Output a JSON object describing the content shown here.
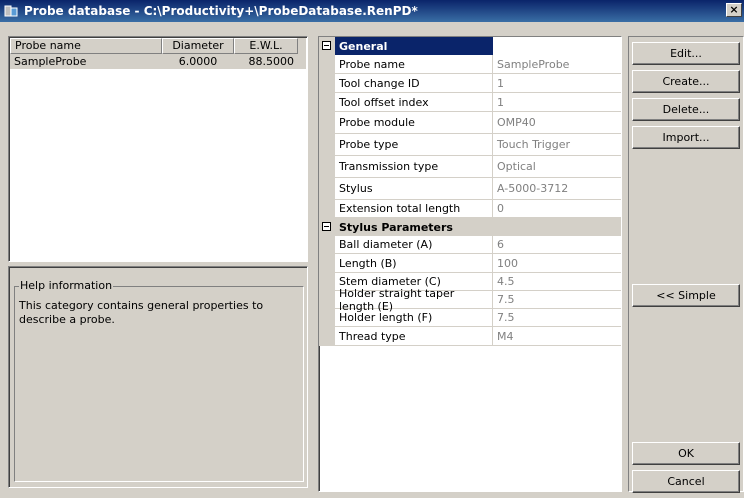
{
  "window": {
    "title": "Probe database - C:\\Productivity+\\ProbeDatabase.RenPD*",
    "close_label": "×"
  },
  "probe_list": {
    "columns": [
      "Probe name",
      "Diameter",
      "E.W.L."
    ],
    "rows": [
      {
        "name": "SampleProbe",
        "diameter": "6.0000",
        "ewl": "88.5000"
      }
    ]
  },
  "help": {
    "legend": "Help information",
    "text": "This category contains general properties to describe a probe."
  },
  "properties": {
    "general": {
      "label": "General",
      "items": [
        {
          "name": "Probe name",
          "value": "SampleProbe"
        },
        {
          "name": "Tool change ID",
          "value": "1"
        },
        {
          "name": "Tool offset index",
          "value": "1"
        },
        {
          "name": "Probe module",
          "value": "OMP40"
        },
        {
          "name": "Probe type",
          "value": "Touch Trigger"
        },
        {
          "name": "Transmission type",
          "value": "Optical"
        },
        {
          "name": "Stylus",
          "value": "A-5000-3712"
        },
        {
          "name": "Extension total length",
          "value": "0"
        }
      ]
    },
    "stylus": {
      "label": "Stylus Parameters",
      "items": [
        {
          "name": "Ball diameter (A)",
          "value": "6"
        },
        {
          "name": "Length (B)",
          "value": "100"
        },
        {
          "name": "Stem diameter (C)",
          "value": "4.5"
        },
        {
          "name": "Holder straight taper length (E)",
          "value": "7.5"
        },
        {
          "name": "Holder length (F)",
          "value": "7.5"
        },
        {
          "name": "Thread type",
          "value": "M4"
        }
      ]
    }
  },
  "buttons": {
    "edit": "Edit...",
    "create": "Create...",
    "delete": "Delete...",
    "import": "Import...",
    "simple": "<< Simple",
    "ok": "OK",
    "cancel": "Cancel"
  }
}
